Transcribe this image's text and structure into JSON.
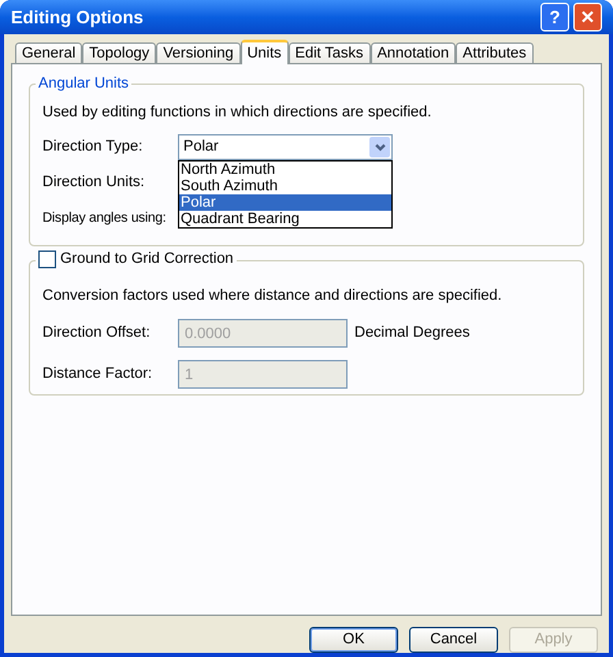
{
  "window": {
    "title": "Editing Options"
  },
  "title_buttons": [
    {
      "kind": "help",
      "label": "?"
    },
    {
      "kind": "close",
      "label": "✕"
    }
  ],
  "tabs": [
    {
      "label": "General",
      "selected": false
    },
    {
      "label": "Topology",
      "selected": false
    },
    {
      "label": "Versioning",
      "selected": false
    },
    {
      "label": "Units",
      "selected": true
    },
    {
      "label": "Edit Tasks",
      "selected": false
    },
    {
      "label": "Annotation",
      "selected": false
    },
    {
      "label": "Attributes",
      "selected": false
    }
  ],
  "angular_units": {
    "title": "Angular Units",
    "description": "Used by editing functions in which directions are specified.",
    "direction_type": {
      "label": "Direction Type:",
      "value": "Polar",
      "expanded": true,
      "options": [
        {
          "label": "North Azimuth",
          "selected": false
        },
        {
          "label": "South Azimuth",
          "selected": false
        },
        {
          "label": "Polar",
          "selected": true
        },
        {
          "label": "Quadrant Bearing",
          "selected": false
        }
      ]
    },
    "direction_units": {
      "label": "Direction Units:"
    },
    "display_angles": {
      "label": "Display angles using:"
    }
  },
  "ground_to_grid": {
    "label": "Ground to Grid Correction",
    "checked": false,
    "description": "Conversion factors used where distance and directions are specified.",
    "fields": [
      {
        "label": "Direction Offset:",
        "value": "0.0000",
        "disabled": true,
        "unit": "Decimal Degrees"
      },
      {
        "label": "Distance Factor:",
        "value": "1",
        "disabled": true
      }
    ]
  },
  "buttons": [
    {
      "label": "OK",
      "disabled": false,
      "default": true
    },
    {
      "label": "Cancel",
      "disabled": false,
      "default": false
    },
    {
      "label": "Apply",
      "disabled": true,
      "default": false
    }
  ]
}
